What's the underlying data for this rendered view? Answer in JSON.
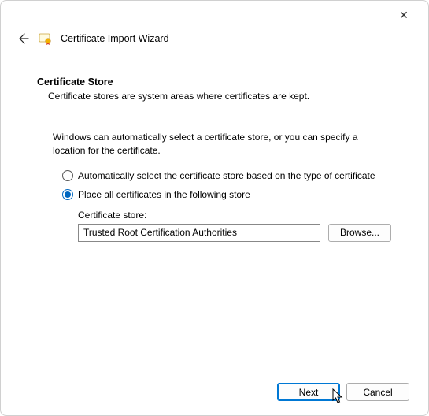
{
  "titlebar": {
    "close_glyph": "✕"
  },
  "header": {
    "title": "Certificate Import Wizard"
  },
  "section": {
    "heading": "Certificate Store",
    "description": "Certificate stores are system areas where certificates are kept."
  },
  "instruction": "Windows can automatically select a certificate store, or you can specify a location for the certificate.",
  "options": {
    "auto": "Automatically select the certificate store based on the type of certificate",
    "manual": "Place all certificates in the following store",
    "selected": "manual"
  },
  "store": {
    "label": "Certificate store:",
    "value": "Trusted Root Certification Authorities",
    "browse_label": "Browse..."
  },
  "footer": {
    "next_label": "Next",
    "cancel_label": "Cancel"
  }
}
